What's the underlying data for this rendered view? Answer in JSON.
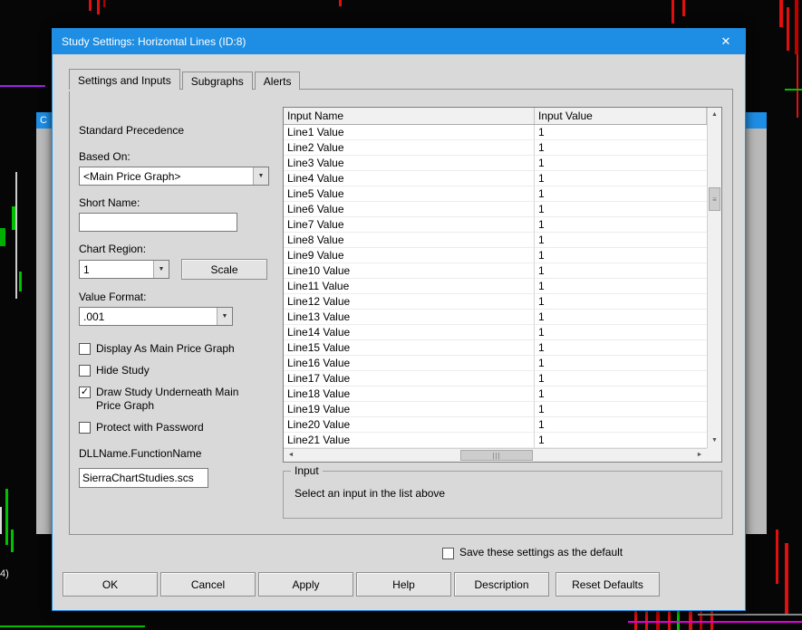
{
  "colors": {
    "titlebar_blue": "#1e8ee4",
    "dialog_gray": "#d9d9d9",
    "chart_red": "#e01010",
    "chart_green": "#00c000",
    "chart_magenta": "#e000e0",
    "chart_purple": "#a020f0"
  },
  "background": {
    "corner_text": "4)",
    "partial_window_title": "C"
  },
  "dialog": {
    "title": "Study Settings: Horizontal Lines (ID:8)",
    "close_glyph": "✕"
  },
  "tabs": [
    {
      "label": "Settings and Inputs",
      "active": true
    },
    {
      "label": "Subgraphs",
      "active": false
    },
    {
      "label": "Alerts",
      "active": false
    }
  ],
  "left": {
    "precedence": "Standard Precedence",
    "based_on_label": "Based On:",
    "based_on_value": "<Main Price Graph>",
    "short_name_label": "Short Name:",
    "short_name_value": "",
    "chart_region_label": "Chart Region:",
    "chart_region_value": "1",
    "scale_button": "Scale",
    "value_format_label": "Value Format:",
    "value_format_value": ".001",
    "checkboxes": [
      {
        "label": "Display As Main Price Graph",
        "checked": false
      },
      {
        "label": "Hide Study",
        "checked": false
      },
      {
        "label": "Draw Study Underneath Main Price Graph",
        "checked": true
      },
      {
        "label": "Protect with Password",
        "checked": false
      }
    ],
    "dll_label": "DLLName.FunctionName",
    "dll_value": "SierraChartStudies.scs"
  },
  "table": {
    "columns": [
      "Input Name",
      "Input Value"
    ],
    "rows": [
      [
        "Line1 Value",
        "1"
      ],
      [
        "Line2 Value",
        "1"
      ],
      [
        "Line3 Value",
        "1"
      ],
      [
        "Line4 Value",
        "1"
      ],
      [
        "Line5 Value",
        "1"
      ],
      [
        "Line6 Value",
        "1"
      ],
      [
        "Line7 Value",
        "1"
      ],
      [
        "Line8 Value",
        "1"
      ],
      [
        "Line9 Value",
        "1"
      ],
      [
        "Line10 Value",
        "1"
      ],
      [
        "Line11 Value",
        "1"
      ],
      [
        "Line12 Value",
        "1"
      ],
      [
        "Line13 Value",
        "1"
      ],
      [
        "Line14 Value",
        "1"
      ],
      [
        "Line15 Value",
        "1"
      ],
      [
        "Line16 Value",
        "1"
      ],
      [
        "Line17 Value",
        "1"
      ],
      [
        "Line18 Value",
        "1"
      ],
      [
        "Line19 Value",
        "1"
      ],
      [
        "Line20 Value",
        "1"
      ],
      [
        "Line21 Value",
        "1"
      ]
    ]
  },
  "input_group": {
    "title": "Input",
    "message": "Select an input in the list above"
  },
  "footer": {
    "save_default_label": "Save these settings as the default",
    "save_default_checked": false,
    "buttons": [
      "OK",
      "Cancel",
      "Apply",
      "Help",
      "Description",
      "Reset Defaults"
    ]
  }
}
